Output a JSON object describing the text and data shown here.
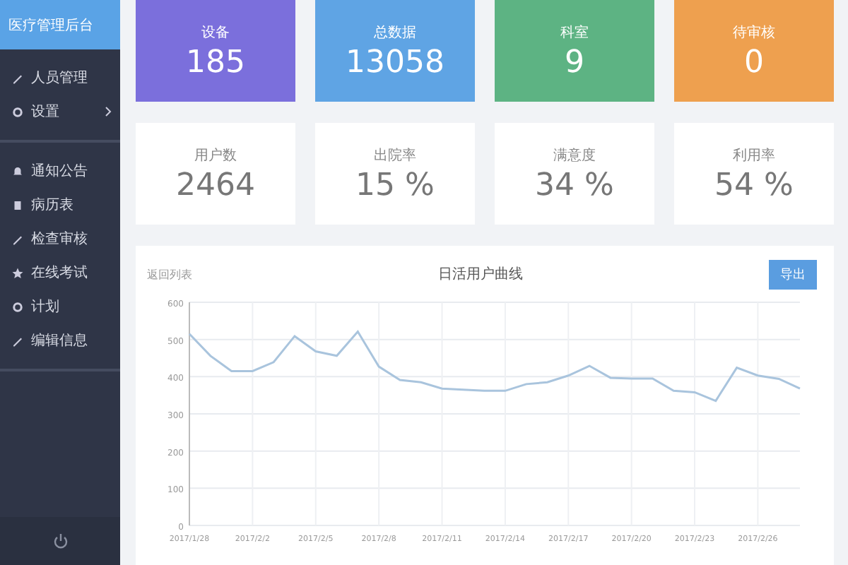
{
  "sidebar": {
    "title": "医疗管理后台",
    "groups": [
      [
        {
          "label": "人员管理",
          "has_submenu": false
        },
        {
          "label": "设置",
          "has_submenu": true
        }
      ],
      [
        {
          "label": "通知公告",
          "has_submenu": false
        },
        {
          "label": "病历表",
          "has_submenu": false
        },
        {
          "label": "检查审核",
          "has_submenu": false
        },
        {
          "label": "在线考试",
          "has_submenu": false
        },
        {
          "label": "计划",
          "has_submenu": false
        },
        {
          "label": "编辑信息",
          "has_submenu": false
        }
      ]
    ]
  },
  "stat_cards": [
    {
      "label": "设备",
      "value": "185",
      "color": "#7b6fdc"
    },
    {
      "label": "总数据",
      "value": "13058",
      "color": "#5fa4e4"
    },
    {
      "label": "科室",
      "value": "9",
      "color": "#5db383"
    },
    {
      "label": "待审核",
      "value": "0",
      "color": "#eea04f"
    }
  ],
  "rate_cards": [
    {
      "label": "用户数",
      "value": "2464"
    },
    {
      "label": "出院率",
      "value": "15 %"
    },
    {
      "label": "满意度",
      "value": "34 %"
    },
    {
      "label": "利用率",
      "value": "54 %"
    }
  ],
  "chart_panel": {
    "back_link": "返回列表",
    "export_button": "导出",
    "chart_data": {
      "type": "line",
      "title": "日活用户曲线",
      "grid": true,
      "categories": [
        "2017/1/28",
        null,
        null,
        "2017/2/2",
        null,
        null,
        "2017/2/5",
        null,
        null,
        "2017/2/8",
        null,
        null,
        "2017/2/11",
        null,
        null,
        "2017/2/14",
        null,
        null,
        "2017/2/17",
        null,
        null,
        "2017/2/20",
        null,
        null,
        "2017/2/23",
        null,
        null,
        "2017/2/26",
        null,
        null
      ],
      "series": [
        {
          "color": "#a9c4dd",
          "values": [
            515,
            456,
            415,
            415,
            439,
            509,
            468,
            456,
            521,
            427,
            391,
            385,
            368,
            365,
            362,
            362,
            380,
            385,
            403,
            429,
            397,
            395,
            395,
            362,
            358,
            335,
            424,
            403,
            394,
            368
          ]
        }
      ],
      "ylim": [
        0,
        600
      ],
      "yticks": [
        0,
        100,
        200,
        300,
        400,
        500,
        600
      ]
    }
  }
}
